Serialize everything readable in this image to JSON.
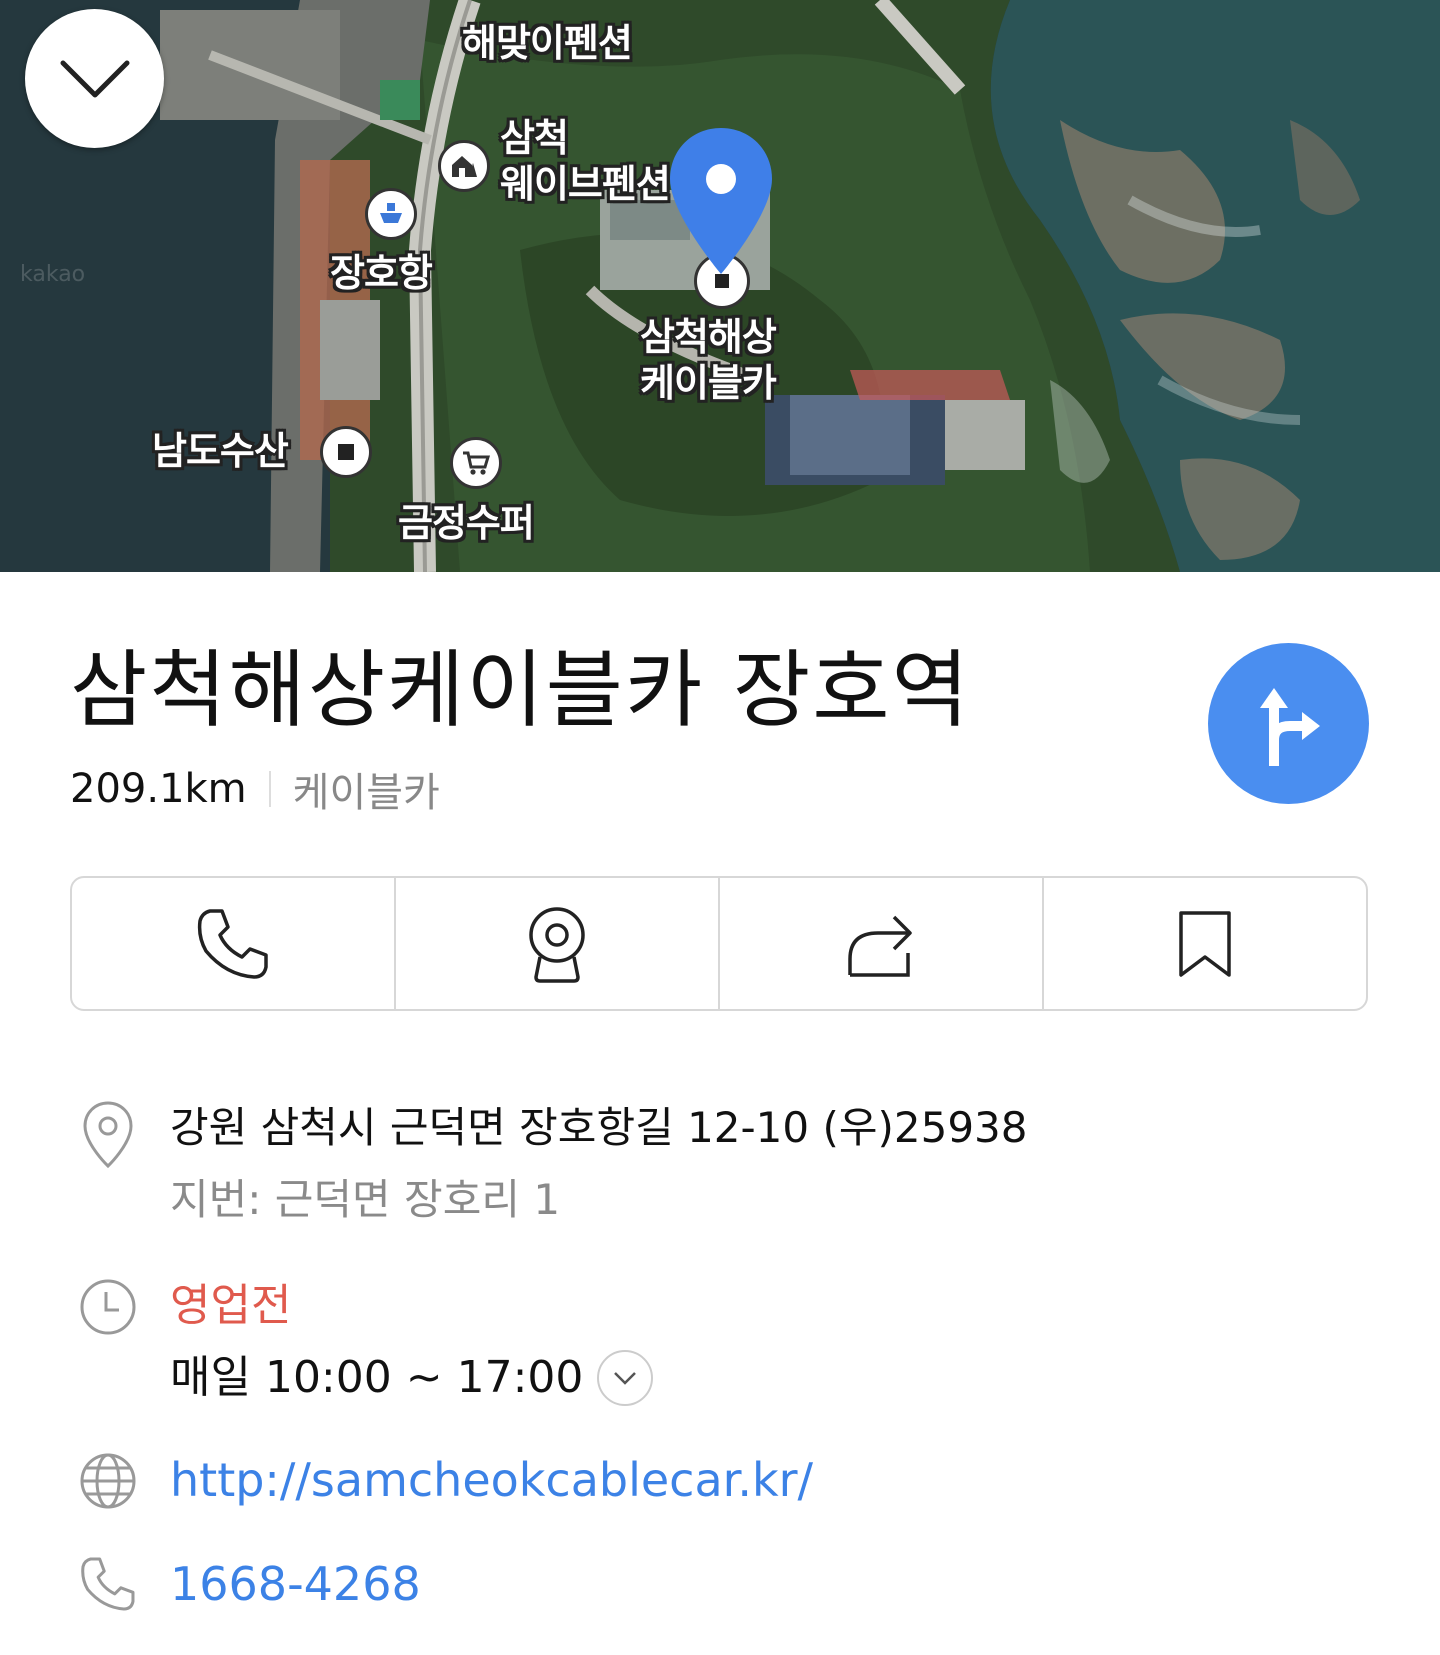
{
  "map": {
    "labels": {
      "haemaji": "해맞이펜션",
      "wave": "삼척\n웨이브펜션",
      "jangho_port": "장호항",
      "cablecar": "삼척해상\n케이블카",
      "namdo": "남도수산",
      "geumjeong": "금정수퍼"
    },
    "watermark": "kakao",
    "icons": [
      "chevron-down-icon",
      "house-icon",
      "ship-icon",
      "square-icon",
      "cart-icon",
      "location-pin-icon"
    ]
  },
  "place": {
    "title": "삼척해상케이블카 장호역",
    "distance": "209.1km",
    "category": "케이블카"
  },
  "actions": [
    "phone-icon",
    "roadview-icon",
    "share-icon",
    "bookmark-icon"
  ],
  "details": {
    "address": "강원 삼척시 근덕면 장호항길 12-10 (우)25938",
    "lot_address": "지번: 근덕면 장호리 1",
    "status": "영업전",
    "hours": "매일 10:00 ~ 17:00",
    "website": "http://samcheokcablecar.kr/",
    "phone": "1668-4268"
  },
  "colors": {
    "accent": "#4a8ef0",
    "status_closed": "#e05a4d",
    "link": "#3c82e6"
  }
}
